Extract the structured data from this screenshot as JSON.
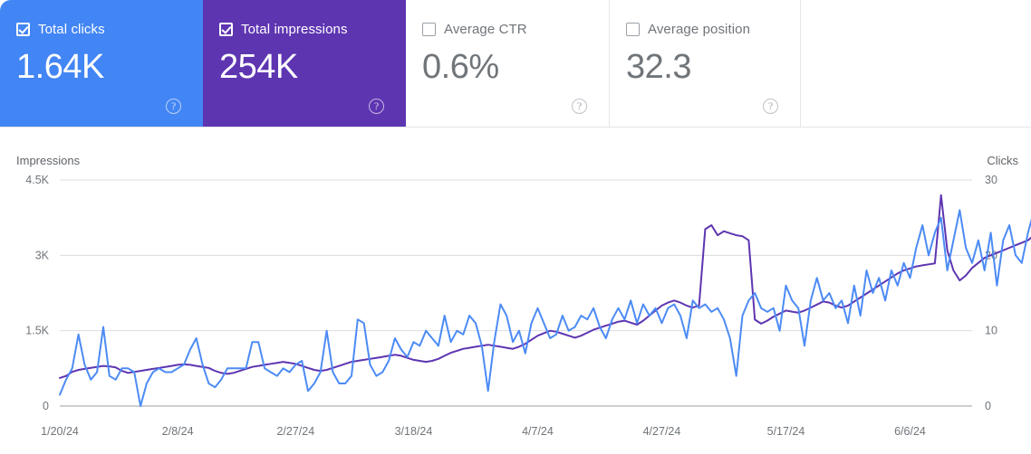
{
  "cards": [
    {
      "label": "Total clicks",
      "value": "1.64K",
      "checked": true,
      "style": "clicks",
      "help": "?"
    },
    {
      "label": "Total impressions",
      "value": "254K",
      "checked": true,
      "style": "impressions",
      "help": "?"
    },
    {
      "label": "Average CTR",
      "value": "0.6%",
      "checked": false,
      "style": "ctr",
      "help": "?"
    },
    {
      "label": "Average position",
      "value": "32.3",
      "checked": false,
      "style": "position",
      "help": "?"
    }
  ],
  "colors": {
    "clicks": "#4285f4",
    "impressions": "#5e35b1",
    "clicks_line": "#4c8bf5",
    "impressions_line": "#5e35b1",
    "grid": "#dadce0",
    "text_muted": "#70757a"
  },
  "chart_data": {
    "type": "line",
    "title": "",
    "ylabel": "Impressions",
    "y2label": "Clicks",
    "xlabel": "",
    "grid": true,
    "legend": "none",
    "ylim": [
      0,
      4500
    ],
    "y2lim": [
      0,
      30
    ],
    "yticks": [
      0,
      1500,
      3000,
      4500
    ],
    "ytick_labels": [
      "0",
      "1.5K",
      "3K",
      "4.5K"
    ],
    "y2ticks": [
      0,
      10,
      20,
      30
    ],
    "y2tick_labels": [
      "0",
      "10",
      "20",
      "30"
    ],
    "xtick_labels": [
      "1/20/24",
      "2/8/24",
      "2/27/24",
      "3/18/24",
      "4/7/24",
      "4/27/24",
      "5/17/24",
      "6/6/24"
    ],
    "xtick_indices": [
      0,
      19,
      38,
      57,
      77,
      97,
      117,
      137
    ],
    "x_start": "1/20/24",
    "x_end": "6/15/24",
    "n_points": 148,
    "series": [
      {
        "name": "Impressions",
        "axis": "left",
        "color": "#5e35b1",
        "values": [
          560,
          600,
          680,
          720,
          740,
          760,
          780,
          800,
          790,
          770,
          700,
          660,
          680,
          700,
          720,
          740,
          760,
          780,
          800,
          820,
          830,
          820,
          800,
          780,
          760,
          700,
          660,
          640,
          660,
          700,
          740,
          780,
          800,
          820,
          840,
          860,
          880,
          860,
          840,
          800,
          760,
          720,
          700,
          720,
          760,
          800,
          840,
          880,
          900,
          920,
          940,
          960,
          980,
          1000,
          1020,
          1000,
          960,
          920,
          900,
          880,
          900,
          940,
          1000,
          1060,
          1100,
          1140,
          1160,
          1180,
          1200,
          1220,
          1200,
          1180,
          1160,
          1140,
          1180,
          1240,
          1320,
          1400,
          1450,
          1500,
          1480,
          1440,
          1400,
          1360,
          1400,
          1460,
          1520,
          1560,
          1600,
          1640,
          1680,
          1700,
          1660,
          1620,
          1700,
          1800,
          1900,
          2000,
          2060,
          2100,
          2060,
          2000,
          1960,
          2000,
          3520,
          3600,
          3400,
          3480,
          3440,
          3400,
          3380,
          3300,
          1720,
          1640,
          1700,
          1780,
          1840,
          1900,
          1880,
          1860,
          1900,
          1960,
          2020,
          2080,
          2060,
          2000,
          1960,
          2000,
          2080,
          2160,
          2240,
          2320,
          2400,
          2480,
          2560,
          2640,
          2700,
          2740,
          2780,
          2800,
          2820,
          2840,
          4200,
          3100,
          2700,
          2500,
          2600,
          2750,
          2850,
          2950,
          3000,
          3050,
          3100,
          3150,
          3200,
          3250,
          3300,
          3400
        ]
      },
      {
        "name": "Clicks",
        "axis": "right",
        "color": "#4c8bf5",
        "values": [
          1.5,
          3.5,
          5,
          9.5,
          5.5,
          3.5,
          4.5,
          10.5,
          4,
          3.5,
          5,
          5,
          4.5,
          0,
          3,
          4.5,
          5,
          4.5,
          4.5,
          5,
          5.5,
          7.5,
          9,
          5.5,
          3,
          2.5,
          3.5,
          5,
          5,
          5,
          5,
          8.5,
          8.5,
          5,
          4.5,
          4,
          5,
          4.5,
          5.5,
          6,
          2,
          3,
          4.5,
          10,
          4.5,
          3,
          3,
          4,
          11.5,
          11,
          5.5,
          4,
          4.5,
          6,
          9,
          7.5,
          6.5,
          8.5,
          8,
          10,
          9,
          8,
          12,
          8.5,
          10,
          9.5,
          12,
          11,
          8,
          2,
          8.5,
          13.5,
          12,
          8.5,
          10,
          7,
          11,
          13,
          11,
          9,
          9.5,
          12,
          10,
          10.5,
          12,
          11.5,
          13,
          10.5,
          9,
          11.5,
          13,
          11.5,
          14,
          11,
          13.5,
          12,
          13,
          11,
          13,
          13.5,
          12,
          9,
          14,
          13,
          13.5,
          12.5,
          13,
          11.5,
          9,
          4,
          12,
          14,
          15,
          13,
          12.5,
          13,
          10,
          16,
          14,
          13,
          8,
          14,
          17,
          14,
          15,
          13,
          14,
          11,
          16,
          12,
          18,
          15,
          17,
          14,
          18,
          16,
          19,
          17,
          21,
          24,
          20,
          23,
          25,
          18,
          22,
          26,
          21,
          19,
          22,
          18,
          23,
          16,
          22,
          24,
          20,
          19,
          23,
          26
        ]
      }
    ]
  }
}
